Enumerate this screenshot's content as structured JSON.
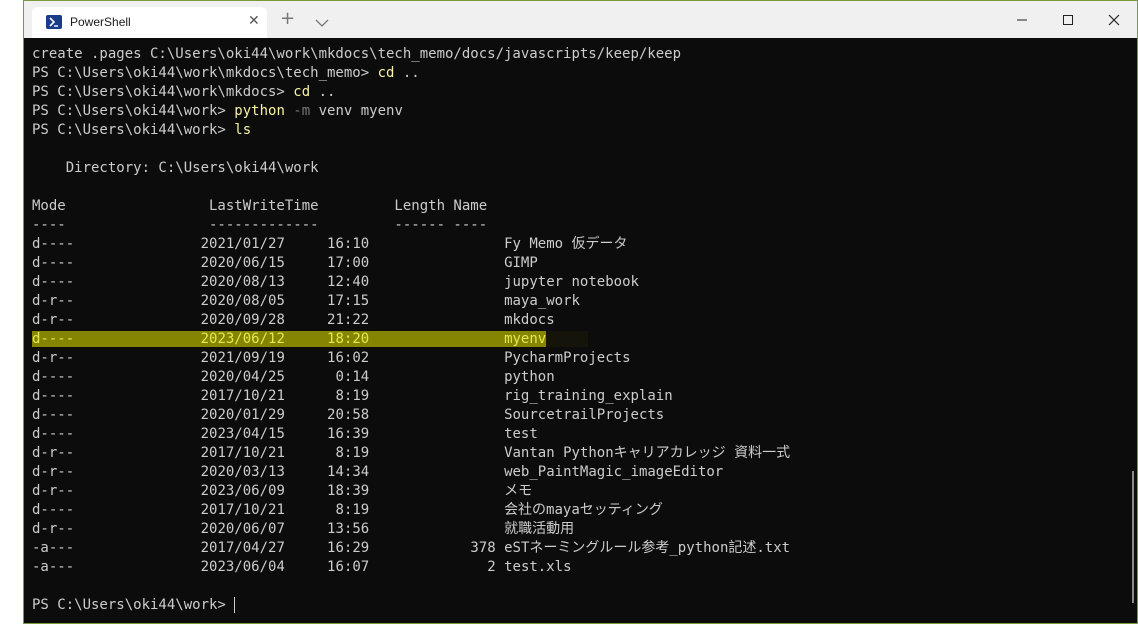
{
  "tab": {
    "title": "PowerShell",
    "close": "✕"
  },
  "newtab": "+",
  "lines": {
    "l1": "create .pages C:\\Users\\oki44\\work\\mkdocs\\tech_memo/docs/javascripts/keep/keep",
    "l2_prompt": "PS C:\\Users\\oki44\\work\\mkdocs\\tech_memo> ",
    "l2_cmd": "cd",
    "l2_arg": " ..",
    "l3_prompt": "PS C:\\Users\\oki44\\work\\mkdocs> ",
    "l3_cmd": "cd",
    "l3_arg": " ..",
    "l4_prompt": "PS C:\\Users\\oki44\\work> ",
    "l4_cmd": "python",
    "l4_flag": " -m",
    "l4_arg": " venv myenv",
    "l5_prompt": "PS C:\\Users\\oki44\\work> ",
    "l5_cmd": "ls",
    "directory": "    Directory: C:\\Users\\oki44\\work",
    "header": "Mode                 LastWriteTime         Length Name",
    "underline": "----                 -------------         ------ ----",
    "final_prompt": "PS C:\\Users\\oki44\\work> "
  },
  "rows": [
    {
      "mode": "d----",
      "date": "2021/01/27",
      "time": "16:10",
      "length": "",
      "name": "Fy Memo 仮データ"
    },
    {
      "mode": "d----",
      "date": "2020/06/15",
      "time": "17:00",
      "length": "",
      "name": "GIMP"
    },
    {
      "mode": "d----",
      "date": "2020/08/13",
      "time": "12:40",
      "length": "",
      "name": "jupyter notebook"
    },
    {
      "mode": "d-r--",
      "date": "2020/08/05",
      "time": "17:15",
      "length": "",
      "name": "maya_work"
    },
    {
      "mode": "d-r--",
      "date": "2020/09/28",
      "time": "21:22",
      "length": "",
      "name": "mkdocs"
    },
    {
      "mode": "d----",
      "date": "2023/06/12",
      "time": "18:20",
      "length": "",
      "name": "myenv",
      "highlight": true
    },
    {
      "mode": "d-r--",
      "date": "2021/09/19",
      "time": "16:02",
      "length": "",
      "name": "PycharmProjects"
    },
    {
      "mode": "d----",
      "date": "2020/04/25",
      "time": "0:14",
      "length": "",
      "name": "python"
    },
    {
      "mode": "d----",
      "date": "2017/10/21",
      "time": "8:19",
      "length": "",
      "name": "rig_training_explain"
    },
    {
      "mode": "d----",
      "date": "2020/01/29",
      "time": "20:58",
      "length": "",
      "name": "SourcetrailProjects"
    },
    {
      "mode": "d----",
      "date": "2023/04/15",
      "time": "16:39",
      "length": "",
      "name": "test"
    },
    {
      "mode": "d-r--",
      "date": "2017/10/21",
      "time": "8:19",
      "length": "",
      "name": "Vantan Pythonキャリアカレッジ 資料一式"
    },
    {
      "mode": "d-r--",
      "date": "2020/03/13",
      "time": "14:34",
      "length": "",
      "name": "web_PaintMagic_imageEditor"
    },
    {
      "mode": "d-r--",
      "date": "2023/06/09",
      "time": "18:39",
      "length": "",
      "name": "メモ"
    },
    {
      "mode": "d----",
      "date": "2017/10/21",
      "time": "8:19",
      "length": "",
      "name": "会社のmayaセッティング"
    },
    {
      "mode": "d-r--",
      "date": "2020/06/07",
      "time": "13:56",
      "length": "",
      "name": "就職活動用"
    },
    {
      "mode": "-a---",
      "date": "2017/04/27",
      "time": "16:29",
      "length": "378",
      "name": "eSTネーミングルール参考_python記述.txt"
    },
    {
      "mode": "-a---",
      "date": "2023/06/04",
      "time": "16:07",
      "length": "2",
      "name": "test.xls"
    }
  ],
  "icons": {
    "tab": "powershell-icon",
    "dropdown": "chevron-down-icon",
    "minimize": "minimize-icon",
    "maximize": "maximize-icon",
    "close": "close-icon"
  },
  "colors": {
    "background": "#0c0c0c",
    "text": "#cccccc",
    "command": "#f9f1a5",
    "parameter": "#767676",
    "highlight_bg": "#858502",
    "highlight_text": "#e8e84a"
  }
}
